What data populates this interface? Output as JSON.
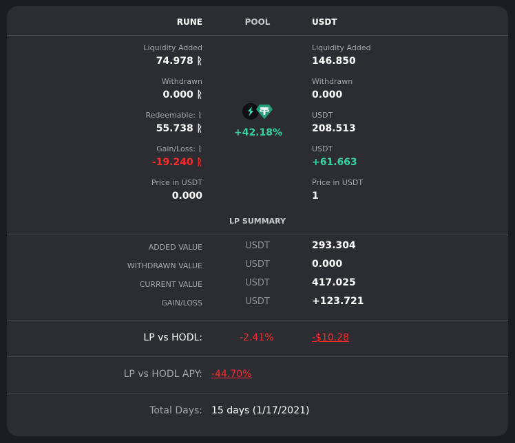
{
  "header": {
    "rune": "RUNE",
    "pool": "POOL",
    "usdt": "USDT"
  },
  "rune": {
    "liquidity_added_label": "Liquidity Added",
    "liquidity_added_value": "74.978 ᚱ",
    "withdrawn_label": "Withdrawn",
    "withdrawn_value": "0.000 ᚱ",
    "redeemable_label": "Redeemable: ᚱ",
    "redeemable_value": "55.738 ᚱ",
    "gainloss_label": "Gain/Loss: ᚱ",
    "gainloss_value": "-19.240 ᚱ",
    "price_label": "Price in USDT",
    "price_value": "0.000"
  },
  "pool": {
    "percent": "+42.18%",
    "icons": [
      "thorchain-icon",
      "tether-icon"
    ]
  },
  "usdt": {
    "liquidity_added_label": "Liquidity Added",
    "liquidity_added_value": "146.850",
    "withdrawn_label": "Withdrawn",
    "withdrawn_value": "0.000",
    "redeemable_label": "USDT",
    "redeemable_value": "208.513",
    "gainloss_label": "USDT",
    "gainloss_value": "+61.663",
    "price_label": "Price in USDT",
    "price_value": "1"
  },
  "summary": {
    "title": "LP SUMMARY",
    "rows": [
      {
        "label": "ADDED VALUE",
        "currency": "USDT",
        "value": "293.304"
      },
      {
        "label": "WITHDRAWN VALUE",
        "currency": "USDT",
        "value": "0.000"
      },
      {
        "label": "CURRENT VALUE",
        "currency": "USDT",
        "value": "417.025"
      },
      {
        "label": "GAIN/LOSS",
        "currency": "USDT",
        "value": "+123.721"
      }
    ]
  },
  "lp_vs_hodl": {
    "label": "LP vs HODL:",
    "percent": "-2.41%",
    "usd": "-$10.28"
  },
  "lp_vs_hodl_apy": {
    "label": "LP vs HODL APY:",
    "value": "-44.70%"
  },
  "total_days": {
    "label": "Total Days:",
    "value": "15 days (1/17/2021)"
  },
  "colors": {
    "positive": "#37d3a0",
    "negative": "#ff2a2a",
    "card": "#2b2d33",
    "background": "#1b1d23"
  }
}
